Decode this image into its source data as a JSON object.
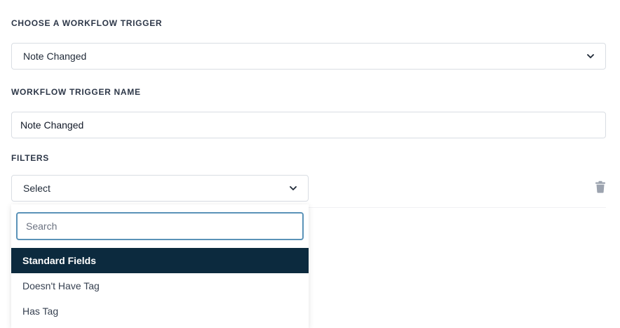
{
  "trigger": {
    "label": "CHOOSE A WORKFLOW TRIGGER",
    "selected": "Note Changed"
  },
  "trigger_name": {
    "label": "WORKFLOW TRIGGER NAME",
    "value": "Note Changed"
  },
  "filters": {
    "label": "FILTERS",
    "select_placeholder": "Select",
    "search_placeholder": "Search",
    "group_header": "Standard Fields",
    "options": [
      "Doesn't Have Tag",
      "Has Tag"
    ]
  },
  "icons": {
    "chevron": "chevron-down-icon",
    "delete": "trash-icon"
  },
  "colors": {
    "group_header_bg": "#0c2a3e",
    "focus_border": "#5b93b8",
    "trash_icon": "#9ca3af"
  }
}
